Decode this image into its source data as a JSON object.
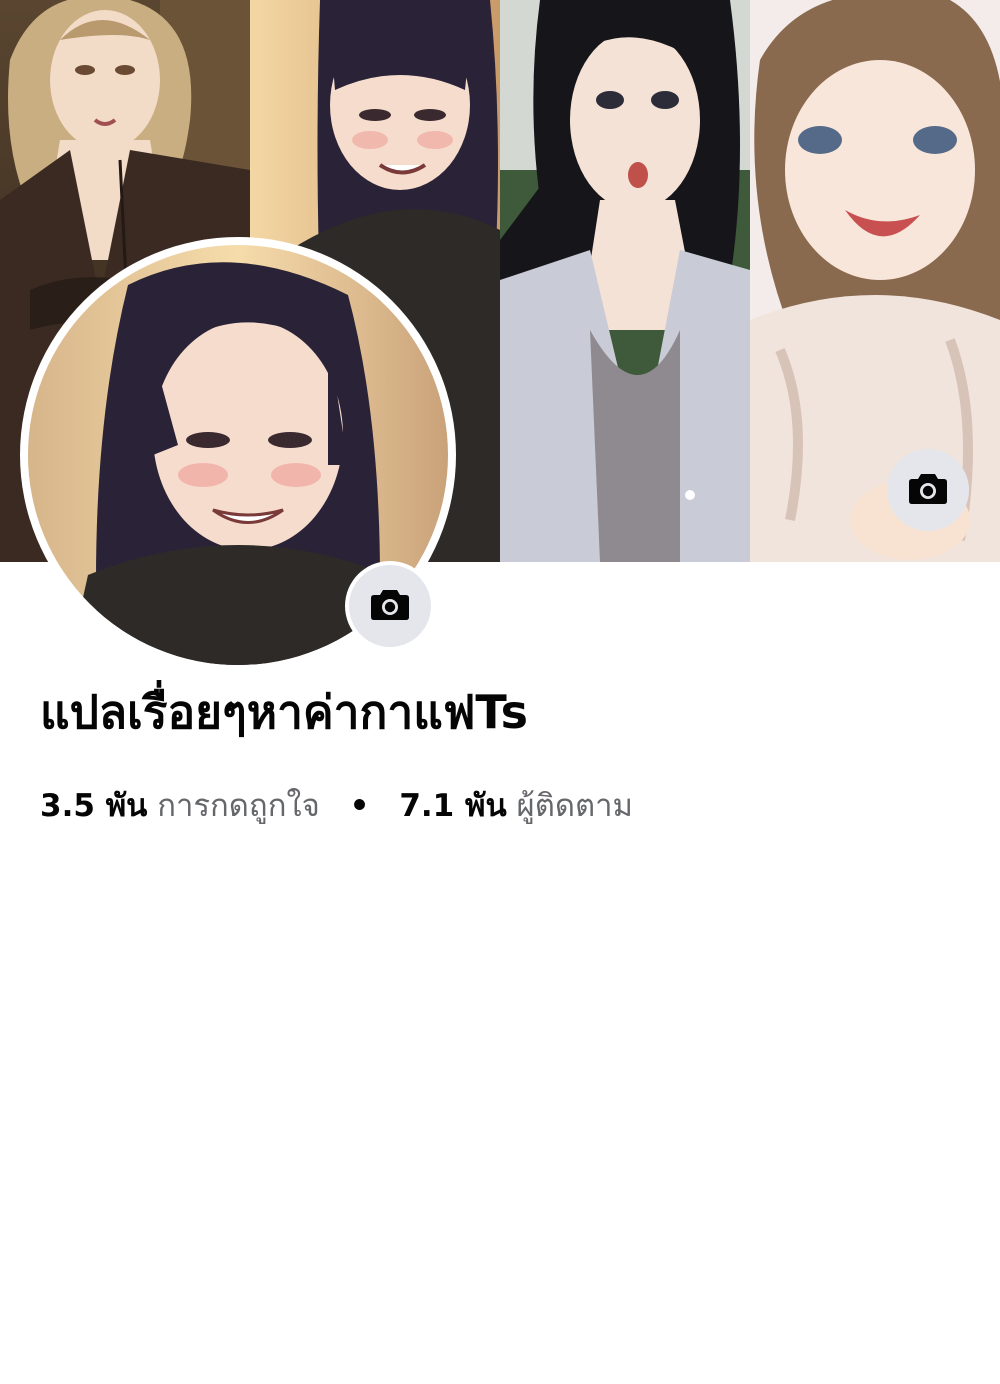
{
  "page": {
    "name": "แปลเรื่อยๆหาค่ากาแฟTs",
    "likes_count": "3.5 พัน",
    "likes_label": "การกดถูกใจ",
    "separator": "•",
    "followers_count": "7.1 พัน",
    "followers_label": "ผู้ติดตาม"
  },
  "icons": {
    "cover_camera": "camera-icon",
    "avatar_camera": "camera-icon"
  },
  "colors": {
    "text_primary": "#050505",
    "text_secondary": "#65676b",
    "button_bg": "#e4e6eb"
  }
}
